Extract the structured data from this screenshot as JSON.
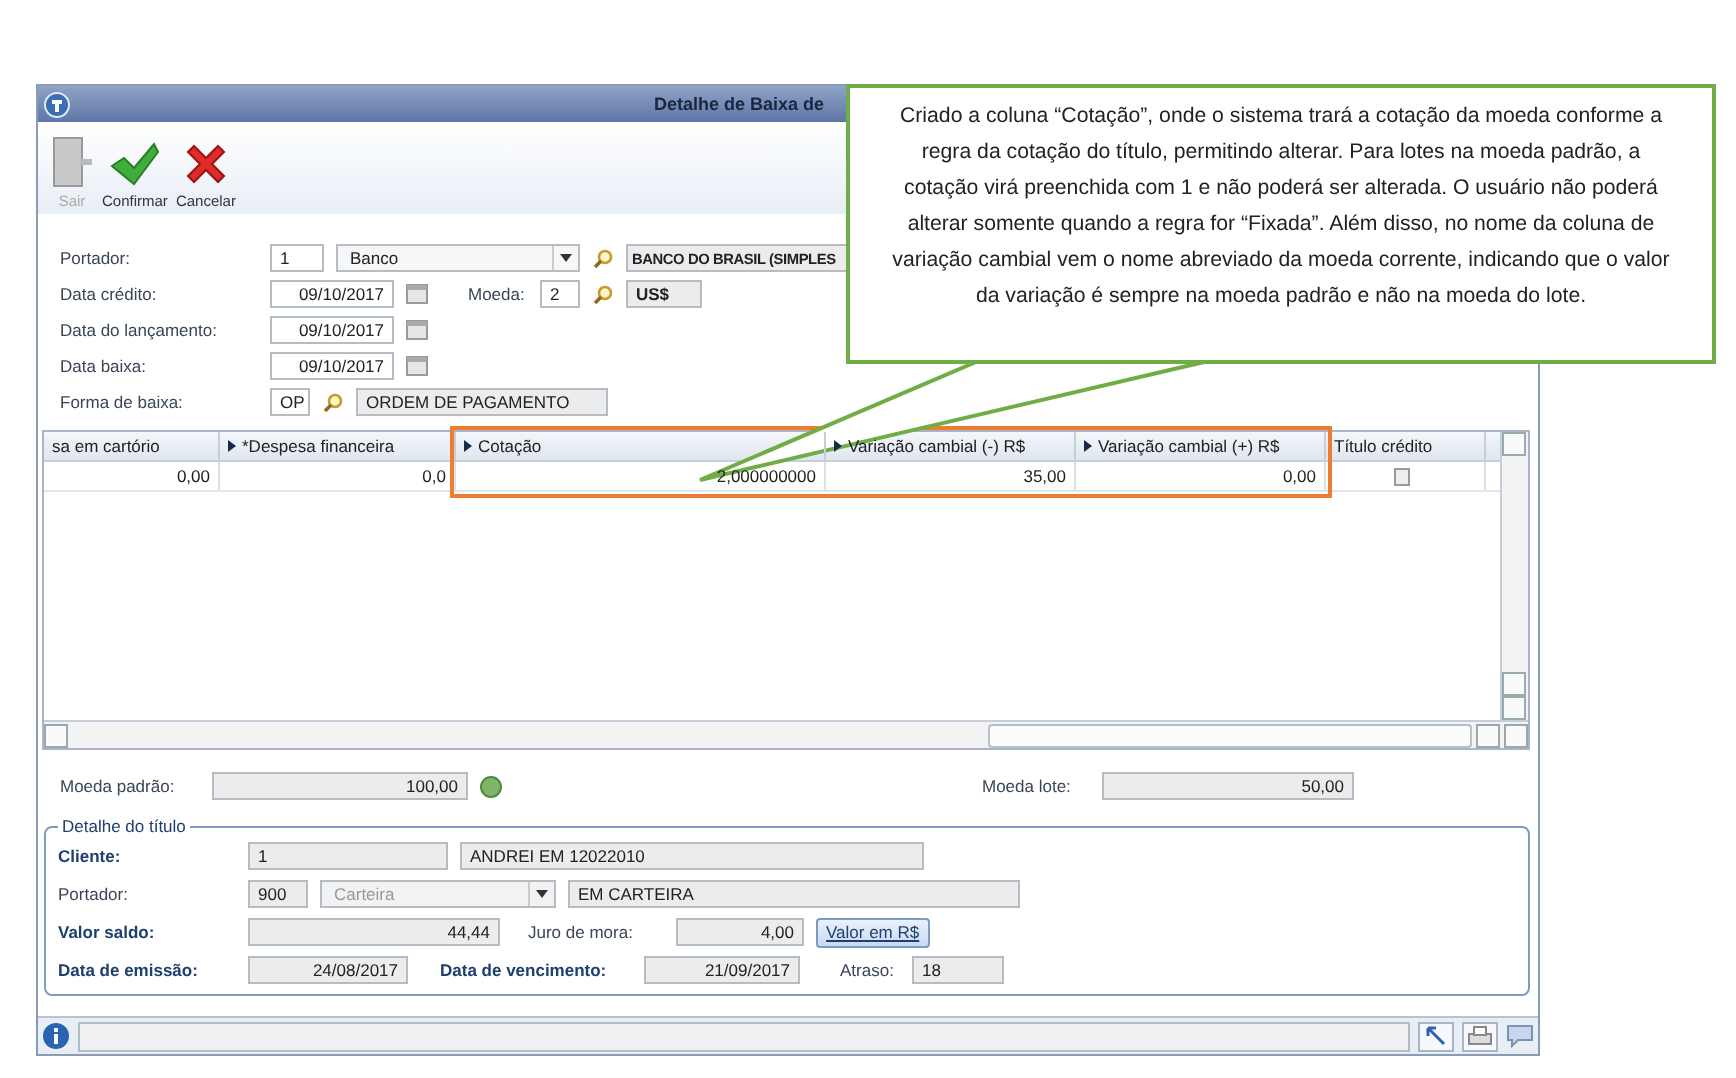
{
  "window": {
    "title": "Detalhe de Baixa de"
  },
  "toolbar": [
    {
      "label": "Sair",
      "disabled": true,
      "kind": "exit"
    },
    {
      "label": "Confirmar",
      "disabled": false,
      "kind": "confirm"
    },
    {
      "label": "Cancelar",
      "disabled": false,
      "kind": "cancel"
    }
  ],
  "form": {
    "portador": {
      "label": "Portador:",
      "code": "1",
      "type": "Banco",
      "description": "BANCO DO BRASIL (SIMPLES"
    },
    "data_credito": {
      "label": "Data crédito:",
      "value": "09/10/2017"
    },
    "moeda": {
      "label": "Moeda:",
      "code": "2",
      "description": "US$"
    },
    "data_lancamento": {
      "label": "Data do lançamento:",
      "value": "09/10/2017"
    },
    "data_baixa": {
      "label": "Data baixa:",
      "value": "09/10/2017"
    },
    "forma_baixa": {
      "label": "Forma de  baixa:",
      "code": "OP",
      "description": "ORDEM DE PAGAMENTO"
    }
  },
  "table": {
    "columns": [
      {
        "label": "sa em cartório",
        "sortable": false
      },
      {
        "label": "*Despesa financeira",
        "sortable": true
      },
      {
        "label": "Cotação",
        "sortable": true
      },
      {
        "label": "Variação cambial (-) R$",
        "sortable": true
      },
      {
        "label": "Variação cambial (+) R$",
        "sortable": true
      },
      {
        "label": "Título crédito",
        "sortable": false
      }
    ],
    "rows": [
      {
        "cells": [
          "0,00",
          "0,0",
          "2,000000000",
          "35,00",
          "0,00",
          ""
        ]
      }
    ]
  },
  "totals": {
    "moeda_padrao": {
      "label": "Moeda padrão:",
      "value": "100,00"
    },
    "moeda_lote": {
      "label": "Moeda lote:",
      "value": "50,00"
    }
  },
  "detail": {
    "title": "Detalhe do título",
    "cliente": {
      "label": "Cliente:",
      "bold": true,
      "code": "1",
      "name": "ANDREI EM 12022010"
    },
    "portador": {
      "label": "Portador:",
      "bold": false,
      "code": "900",
      "type": "Carteira",
      "description": "EM CARTEIRA"
    },
    "valor_saldo": {
      "label": "Valor saldo:",
      "bold": true,
      "value": "44,44"
    },
    "juro_mora": {
      "label": "Juro de mora:",
      "bold": false,
      "value": "4,00"
    },
    "valor_button": "Valor em R$",
    "data_emissao": {
      "label": "Data de emissão:",
      "bold": true,
      "value": "24/08/2017"
    },
    "data_vencimento": {
      "label": "Data de vencimento:",
      "bold": true,
      "value": "21/09/2017"
    },
    "atraso": {
      "label": "Atraso:",
      "bold": false,
      "value": "18"
    }
  },
  "callout": {
    "text": "Criado a coluna “Cotação”, onde o sistema trará a cotação da moeda conforme a regra da cotação do título, permitindo alterar. Para lotes na moeda padrão, a cotação virá preenchida com 1 e não poderá ser alterada. O usuário não poderá alterar somente quando a regra for “Fixada”. Além disso, no nome da coluna de variação cambial vem o nome abreviado da moeda corrente, indicando que o valor da variação é sempre na moeda padrão e não na moeda do lote."
  }
}
